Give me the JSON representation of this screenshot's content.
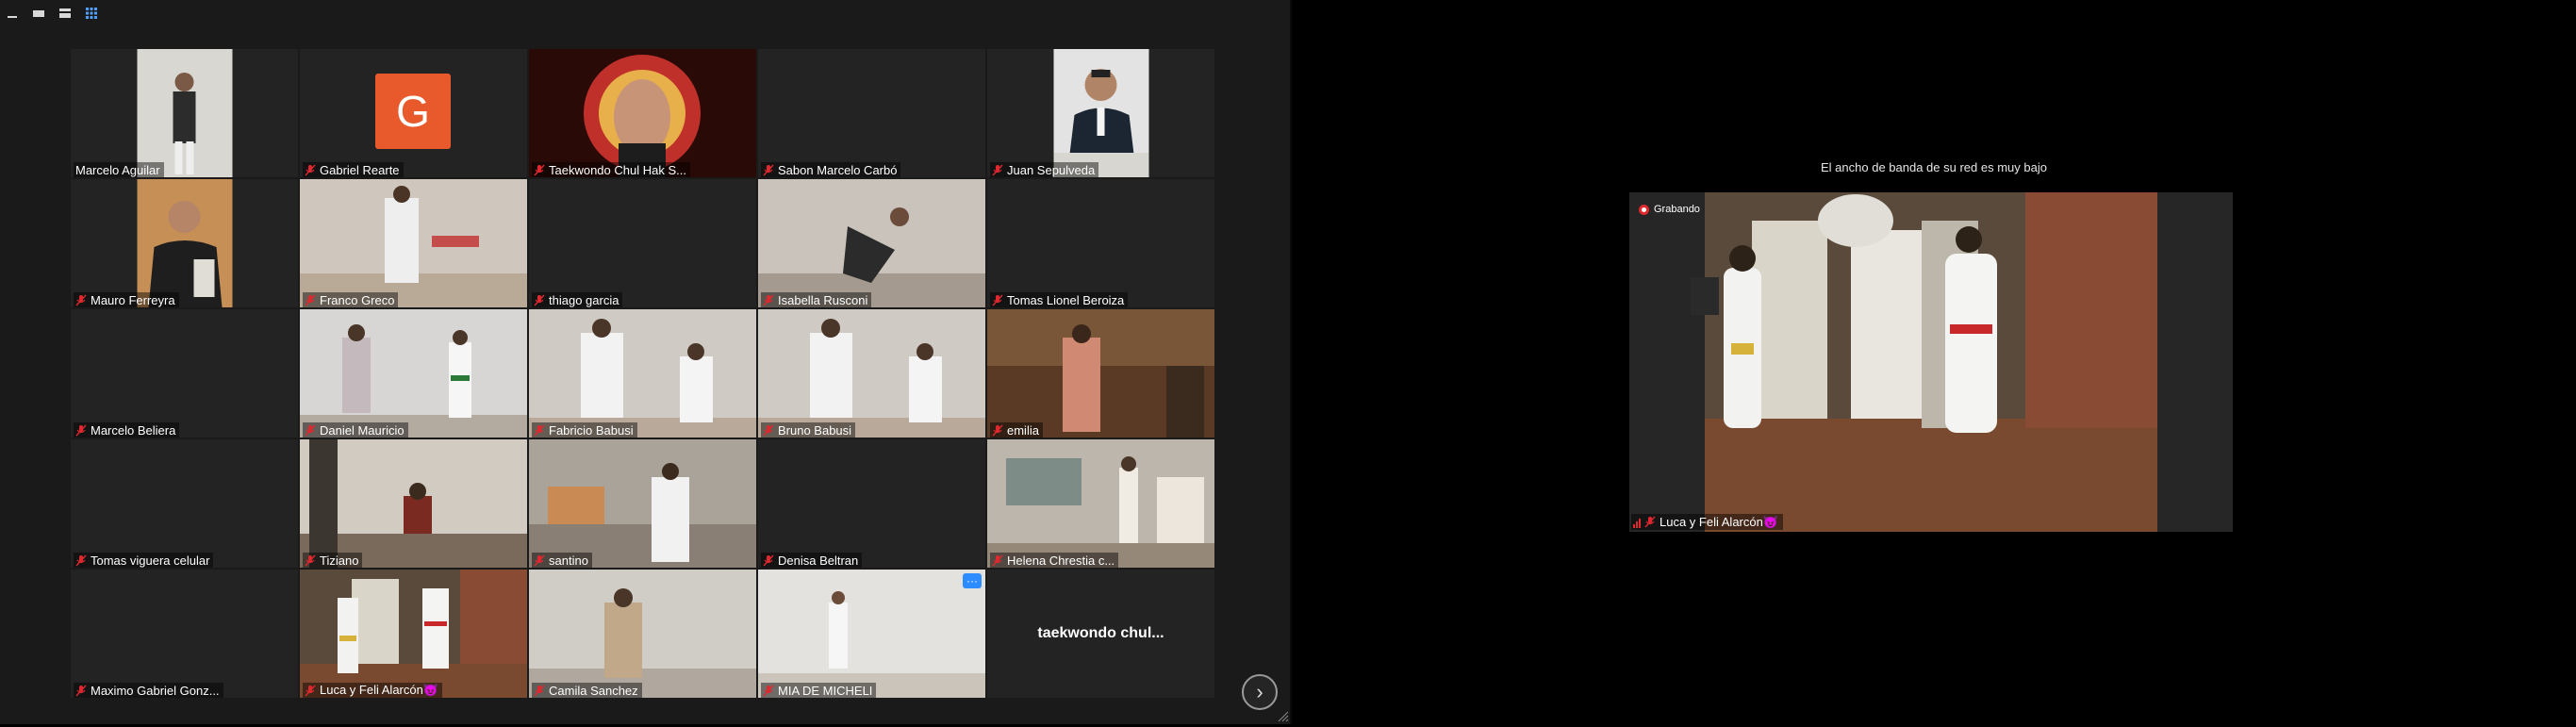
{
  "toolbar": {
    "icons": [
      "minimize-icon",
      "speaker-view-icon",
      "strip-view-icon",
      "gallery-view-icon"
    ]
  },
  "gallery": {
    "tiles": [
      {
        "name": "Marcelo Aguilar",
        "muted": false,
        "video": "standing-person"
      },
      {
        "name": "Gabriel Rearte",
        "muted": true,
        "video": "avatar",
        "avatar_letter": "G"
      },
      {
        "name": "Taekwondo Chul Hak S...",
        "muted": true,
        "video": "logo-man"
      },
      {
        "name": "Sabon Marcelo Carbó",
        "muted": true,
        "video": "none"
      },
      {
        "name": "Juan Sepulveda",
        "muted": true,
        "video": "suit-man"
      },
      {
        "name": "Mauro Ferreyra",
        "muted": true,
        "video": "seated-man"
      },
      {
        "name": "Franco Greco",
        "muted": true,
        "video": "room-kick"
      },
      {
        "name": "thiago garcia",
        "muted": true,
        "video": "none"
      },
      {
        "name": "Isabella Rusconi",
        "muted": true,
        "video": "room-jump"
      },
      {
        "name": "Tomas Lionel Beroiza",
        "muted": true,
        "video": "none"
      },
      {
        "name": "Marcelo Beliera",
        "muted": true,
        "video": "none"
      },
      {
        "name": "Daniel Mauricio",
        "muted": true,
        "video": "room-two"
      },
      {
        "name": "Fabricio Babusi",
        "muted": true,
        "video": "room-two-kids"
      },
      {
        "name": "Bruno Babusi",
        "muted": true,
        "video": "room-two-kids"
      },
      {
        "name": "emilia",
        "muted": true,
        "video": "dark-room"
      },
      {
        "name": "Tomas viguera celular",
        "muted": true,
        "video": "none"
      },
      {
        "name": "Tiziano",
        "muted": true,
        "video": "room-kid"
      },
      {
        "name": "santino",
        "muted": true,
        "video": "living-room"
      },
      {
        "name": "Denisa Beltran",
        "muted": true,
        "video": "none"
      },
      {
        "name": "Helena Chrestia c...",
        "muted": true,
        "video": "kitchen"
      },
      {
        "name": "Maximo Gabriel Gonz...",
        "muted": true,
        "video": "none"
      },
      {
        "name": "Luca y Feli Alarcón😈",
        "muted": true,
        "video": "brick-room",
        "active": true
      },
      {
        "name": "Camila Sanchez",
        "muted": true,
        "video": "white-room"
      },
      {
        "name": "MIA DE MICHELI",
        "muted": true,
        "video": "bright-room",
        "more_button": true
      },
      {
        "name": "taekwondo chul...",
        "muted": false,
        "video": "name-only"
      }
    ],
    "more_label": "···",
    "next_label": "›"
  },
  "speaker": {
    "bandwidth_warning": "El ancho de banda de su red es muy bajo",
    "recording_label": "Grabando",
    "name": "Luca y Feli Alarcón😈"
  },
  "colors": {
    "muted_red": "#e0282f",
    "active_border": "#f0d24a",
    "avatar_orange": "#e8592b",
    "accent_blue": "#2d8cff"
  }
}
